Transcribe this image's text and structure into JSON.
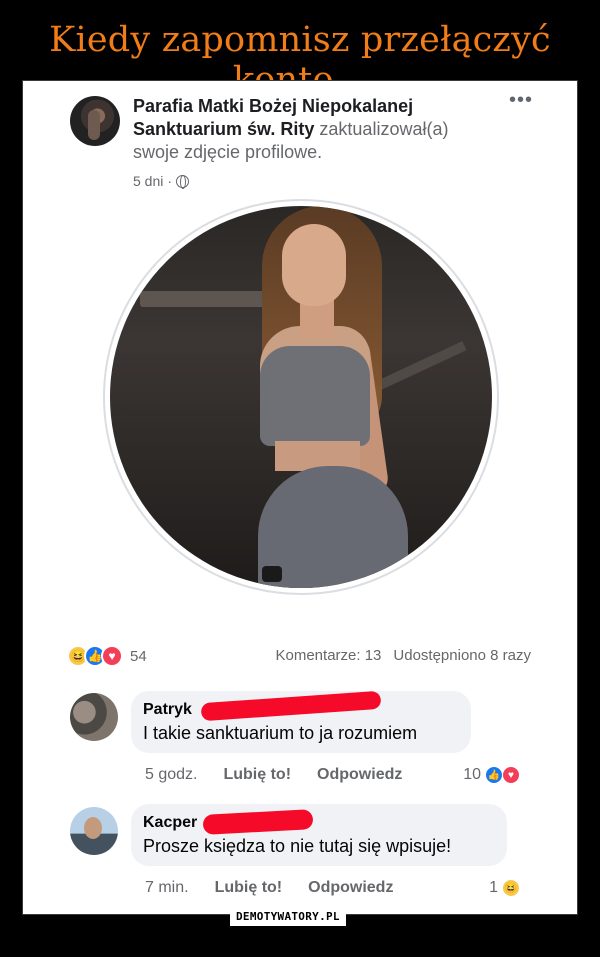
{
  "meme": {
    "title": "Kiedy zapomnisz przełączyć konto...",
    "watermark": "DEMOTYWATORY.PL",
    "title_color": "#f07d17"
  },
  "post": {
    "author": "Parafia  Matki Bożej Niepokalanej Sanktuarium św. Rity",
    "action": "zaktualizował(a) swoje zdjęcie profilowe.",
    "time": "5 dni",
    "separator": "·",
    "privacy_icon": "globe-icon",
    "more_icon": "•••",
    "reactions_count": "54",
    "reaction_icons": [
      "haha-icon",
      "like-icon",
      "love-icon"
    ],
    "comments_count": "Komentarze: 13",
    "shares_count": "Udostępniono 8 razy"
  },
  "comments": [
    {
      "name": "Patryk",
      "text": "I takie sanktuarium to ja rozumiem",
      "time": "5 godz.",
      "like_label": "Lubię to!",
      "reply_label": "Odpowiedz",
      "reactions_count": "10",
      "reaction_icons": [
        "like-icon",
        "love-icon"
      ]
    },
    {
      "name": "Kacper",
      "text": "Prosze księdza to nie tutaj się wpisuje!",
      "time": "7 min.",
      "like_label": "Lubię to!",
      "reply_label": "Odpowiedz",
      "reactions_count": "1",
      "reaction_icons": [
        "haha-icon"
      ]
    }
  ],
  "colors": {
    "like_blue": "#1877f2",
    "love_red": "#f33e58",
    "haha_yellow": "#f7c94a",
    "redaction": "#f50a2a"
  }
}
